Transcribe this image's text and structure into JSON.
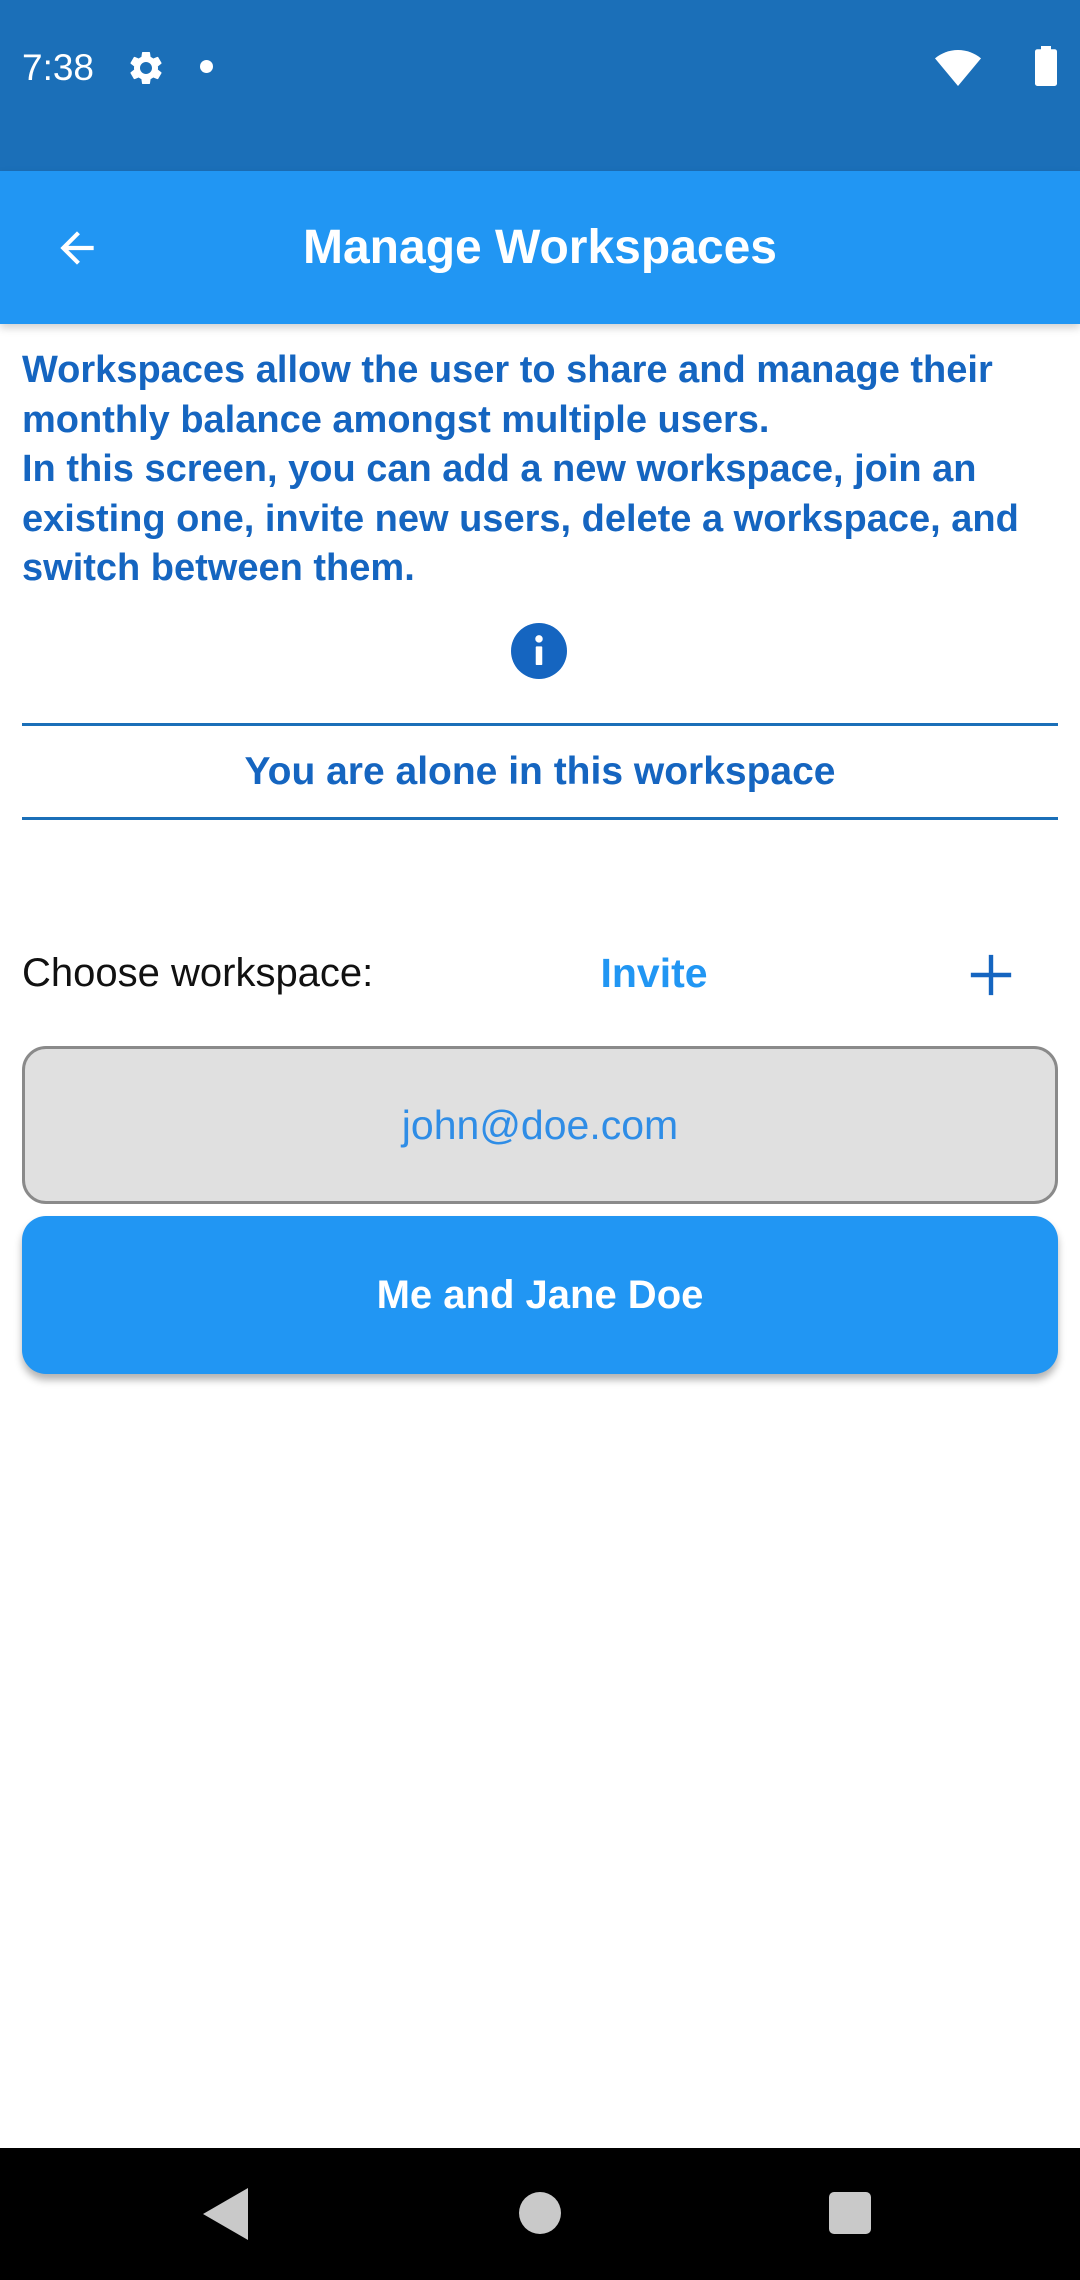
{
  "status_bar": {
    "time": "7:38",
    "icons": [
      "gear-icon",
      "notification-dot-icon",
      "wifi-icon",
      "battery-icon"
    ]
  },
  "app_bar": {
    "title": "Manage Workspaces",
    "back_icon": "arrow-left-icon"
  },
  "description": "Workspaces allow the user to share and manage their monthly balance amongst multiple users.\nIn this screen, you can add a new workspace, join an existing one, invite new users, delete a workspace, and switch between them.",
  "info_icon": "info-icon",
  "workspace_status": "You are alone in this workspace",
  "workspace_row": {
    "choose_label": "Choose workspace:",
    "invite_label": "Invite",
    "add_icon": "plus-icon"
  },
  "email_field": {
    "value": "",
    "placeholder": "john@doe.com"
  },
  "workspace_button_label": "Me and Jane Doe",
  "nav_bar": {
    "icons": [
      "back-triangle-icon",
      "home-circle-icon",
      "recents-square-icon"
    ]
  },
  "colors": {
    "status_bar": "#1b6fb8",
    "app_bar": "#2196f3",
    "accent_text": "#1565c0",
    "button": "#2196f3",
    "field_background": "#e0e0e0"
  }
}
